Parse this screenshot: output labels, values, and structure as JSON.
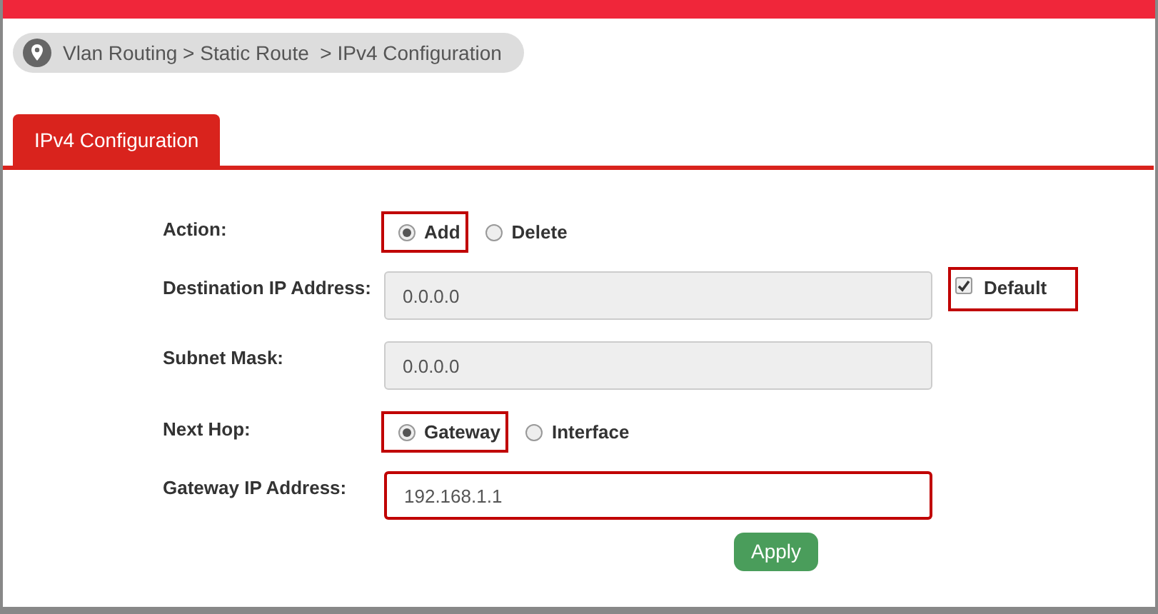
{
  "breadcrumb": "Vlan Routing > Static Route  > IPv4 Configuration",
  "tabs": [
    {
      "label": "IPv4 Configuration",
      "selected": true
    }
  ],
  "form": [
    {
      "kind": "radio",
      "label": "Action:",
      "options": [
        {
          "label": "Add",
          "selected": true,
          "highlighted": true
        },
        {
          "label": "Delete",
          "selected": false,
          "highlighted": false
        }
      ]
    },
    {
      "kind": "field",
      "label": "Destination IP Address:",
      "value": "0.0.0.0",
      "disabled": true,
      "highlighted": false,
      "checkbox": {
        "label": "Default",
        "checked": true,
        "highlighted": true
      }
    },
    {
      "kind": "field",
      "label": "Subnet Mask:",
      "value": "0.0.0.0",
      "disabled": true,
      "highlighted": false
    },
    {
      "kind": "radio",
      "label": "Next Hop:",
      "options": [
        {
          "label": "Gateway",
          "selected": true,
          "highlighted": true
        },
        {
          "label": "Interface",
          "selected": false,
          "highlighted": false
        }
      ]
    },
    {
      "kind": "field",
      "label": "Gateway IP Address:",
      "value": "192.168.1.1",
      "disabled": false,
      "highlighted": true
    }
  ],
  "apply_button": "Apply"
}
